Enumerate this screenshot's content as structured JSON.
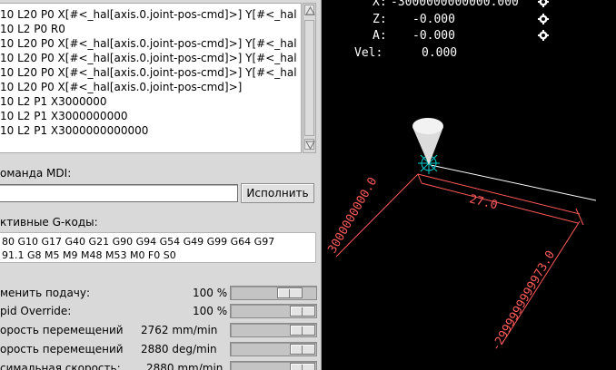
{
  "history": {
    "lines": [
      "10 L20 P0  X[#<_hal[axis.0.joint-pos-cmd]>] Y[#<_hal",
      "10 L2 P0 R0",
      "10 L20 P0  X[#<_hal[axis.0.joint-pos-cmd]>] Y[#<_hal",
      "10 L20 P0  X[#<_hal[axis.0.joint-pos-cmd]>] Y[#<_hal",
      "10 L20 P0  X[#<_hal[axis.0.joint-pos-cmd]>] Y[#<_hal",
      "10 L20 P0  X[#<_hal[axis.0.joint-pos-cmd]>]",
      "10 L2 P1 X3000000",
      "10 L2 P1 X3000000000",
      "10 L2 P1 X3000000000000"
    ]
  },
  "mdi": {
    "label": "оманда MDI:",
    "input_value": "",
    "run_button": "Исполнить"
  },
  "gcodes": {
    "label": "ктивные G-коды:",
    "line1": "80 G10 G17 G40 G21 G90 G94 G54 G49 G99 G64 G97",
    "line2": "91.1 G8 M5 M9 M48 M53 M0 F0 S0"
  },
  "overrides": [
    {
      "label": "менить подачу:",
      "value": "100 %",
      "level": 0.78
    },
    {
      "label": "pid Override:",
      "value": "100 %",
      "level": 1.0
    },
    {
      "label": "орость перемещений",
      "value": "2762 mm/min",
      "level": 1.0
    },
    {
      "label": "орость перемещений",
      "value": "2880 deg/min",
      "level": 1.0
    },
    {
      "label": "симальная скорость:",
      "value": "2880 mm/min",
      "level": 1.0
    }
  ],
  "dro": {
    "x_label": "X:",
    "x_value": "-3000000000000.000",
    "z_label": "Z:",
    "z_value": "-0.000",
    "a_label": "A:",
    "a_value": "-0.000",
    "vel_label": "Vel:",
    "vel_value": "0.000"
  },
  "plot": {
    "dim_x": "27.0",
    "dim_left": "3000000000.0",
    "dim_right": "-2999999999973.0",
    "colors": {
      "dimension": "#ff5a5a",
      "tool": "#dcdcdc",
      "origin": "#00d0d0",
      "path": "#ffffff"
    }
  }
}
